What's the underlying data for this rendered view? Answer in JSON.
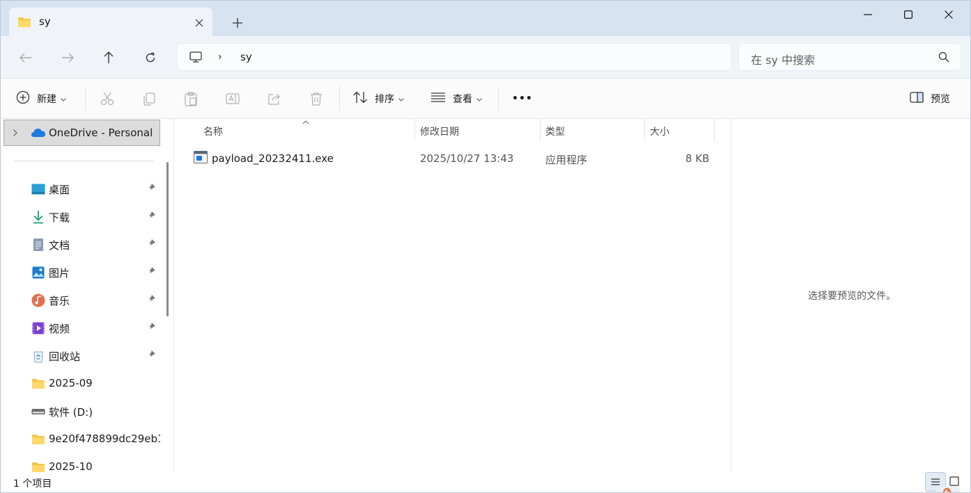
{
  "tab": {
    "title": "sy"
  },
  "address": {
    "crumb": "sy",
    "separator": "›"
  },
  "search": {
    "placeholder": "在 sy 中搜索"
  },
  "toolbar": {
    "new_label": "新建",
    "sort_label": "排序",
    "view_label": "查看",
    "more_label": "•••",
    "preview_label": "预览"
  },
  "sidebar": {
    "onedrive_label": "OneDrive - Personal",
    "items": [
      {
        "label": "桌面",
        "icon": "desktop-icon",
        "pinned": true
      },
      {
        "label": "下载",
        "icon": "download-icon",
        "pinned": true
      },
      {
        "label": "文档",
        "icon": "documents-icon",
        "pinned": true
      },
      {
        "label": "图片",
        "icon": "pictures-icon",
        "pinned": true
      },
      {
        "label": "音乐",
        "icon": "music-icon",
        "pinned": true
      },
      {
        "label": "视频",
        "icon": "videos-icon",
        "pinned": true
      },
      {
        "label": "回收站",
        "icon": "recycle-bin-icon",
        "pinned": true
      },
      {
        "label": "2025-09",
        "icon": "folder-icon",
        "pinned": false
      },
      {
        "label": "软件 (D:)",
        "icon": "drive-icon",
        "pinned": false
      },
      {
        "label": "9e20f478899dc29eb1",
        "icon": "folder-icon",
        "pinned": false
      },
      {
        "label": "2025-10",
        "icon": "folder-icon",
        "pinned": false
      }
    ]
  },
  "columns": {
    "name": "名称",
    "modified": "修改日期",
    "type": "类型",
    "size": "大小"
  },
  "files": [
    {
      "name": "payload_20232411.exe",
      "modified": "2025/10/27 13:43",
      "type": "应用程序",
      "size": "8 KB"
    }
  ],
  "preview": {
    "message": "选择要预览的文件。"
  },
  "status": {
    "count": "1 个项目"
  },
  "colors": {
    "accent": "#0067c0",
    "titlebar": "#d7e3f0",
    "navbar": "#f0f4f9",
    "folder": "#f5c545"
  }
}
